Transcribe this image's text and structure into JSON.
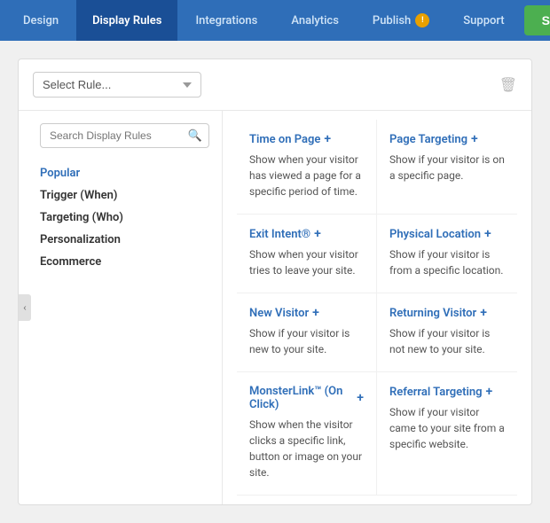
{
  "nav": {
    "tabs": [
      {
        "id": "design",
        "label": "Design",
        "active": false
      },
      {
        "id": "display-rules",
        "label": "Display Rules",
        "active": true
      },
      {
        "id": "integrations",
        "label": "Integrations",
        "active": false
      },
      {
        "id": "analytics",
        "label": "Analytics",
        "active": false
      },
      {
        "id": "publish",
        "label": "Publish",
        "active": false,
        "has_badge": true,
        "badge": "!"
      },
      {
        "id": "support",
        "label": "Support",
        "active": false
      }
    ],
    "save_label": "Save"
  },
  "select_rule": {
    "placeholder": "Select Rule...",
    "options": [
      "Select Rule..."
    ]
  },
  "sidebar": {
    "search_placeholder": "Search Display Rules",
    "categories": [
      {
        "id": "popular",
        "label": "Popular",
        "highlight": true
      },
      {
        "id": "trigger",
        "label": "Trigger (When)",
        "highlight": false
      },
      {
        "id": "targeting",
        "label": "Targeting (Who)",
        "highlight": false
      },
      {
        "id": "personalization",
        "label": "Personalization",
        "highlight": false
      },
      {
        "id": "ecommerce",
        "label": "Ecommerce",
        "highlight": false
      }
    ]
  },
  "rules": [
    {
      "title": "Time on Page",
      "desc": "Show when your visitor has viewed a page for a specific period of time.",
      "col": "left"
    },
    {
      "title": "Page Targeting",
      "desc": "Show if your visitor is on a specific page.",
      "col": "right"
    },
    {
      "title": "Exit Intent®",
      "desc": "Show when your visitor tries to leave your site.",
      "col": "left"
    },
    {
      "title": "Physical Location",
      "desc": "Show if your visitor is from a specific location.",
      "col": "right"
    },
    {
      "title": "New Visitor",
      "desc": "Show if your visitor is new to your site.",
      "col": "left"
    },
    {
      "title": "Returning Visitor",
      "desc": "Show if your visitor is not new to your site.",
      "col": "right"
    },
    {
      "title": "MonsterLink™ (On Click)",
      "desc": "Show when the visitor clicks a specific link, button or image on your site.",
      "col": "left"
    },
    {
      "title": "Referral Targeting",
      "desc": "Show if your visitor came to your site from a specific website.",
      "col": "right"
    }
  ]
}
